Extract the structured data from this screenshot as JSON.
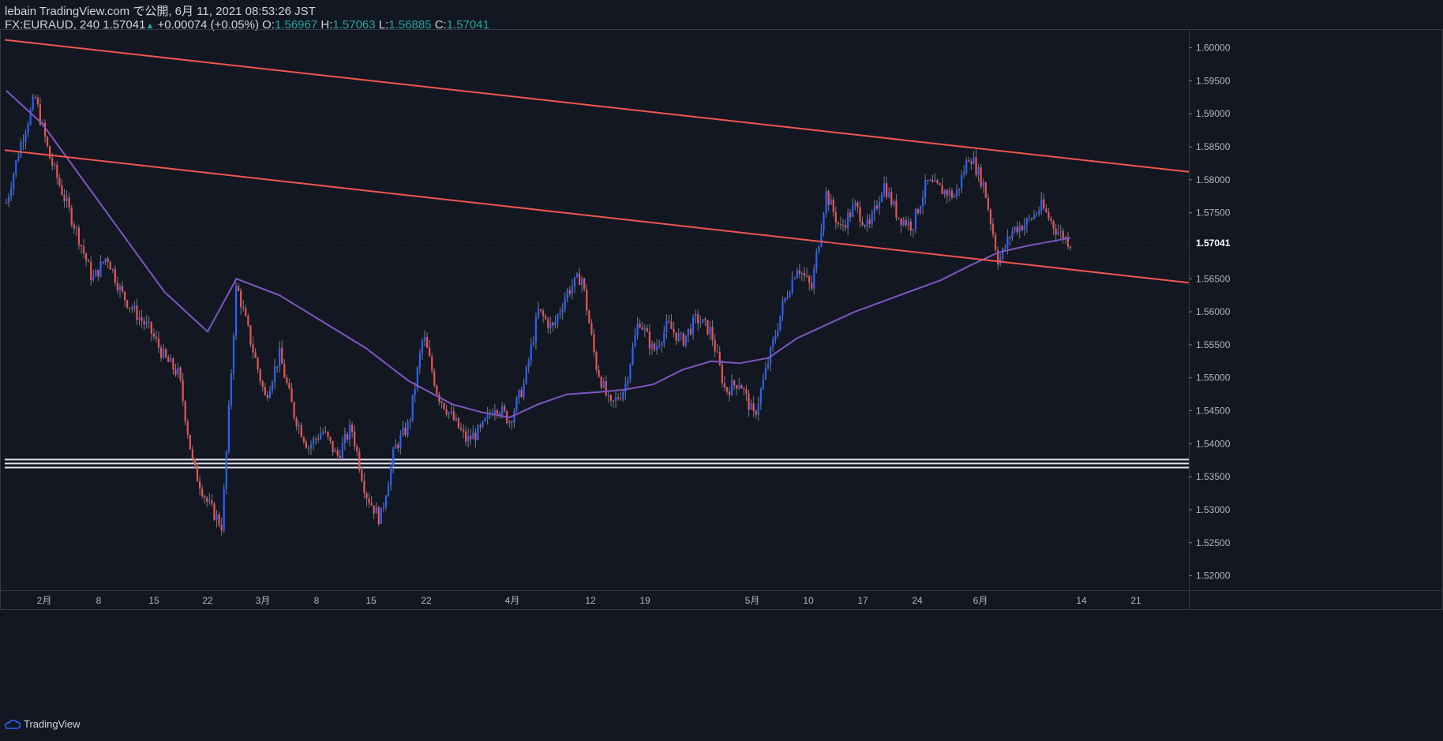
{
  "header": {
    "line1": "lebain TradingView.com で公開, 6月 11, 2021 08:53:26 JST",
    "symbol": "FX:EURAUD, 240",
    "last": "1.57041",
    "change": "+0.00074 (+0.05%)",
    "o_label": "O:",
    "o_val": "1.56967",
    "h_label": "H:",
    "h_val": "1.57063",
    "l_label": "L:",
    "l_val": "1.56885",
    "c_label": "C:",
    "c_val": "1.57041"
  },
  "footer": {
    "brand": "TradingView"
  },
  "colors": {
    "background": "#131722",
    "up": "#2962ff",
    "down": "#ef5350",
    "trendline": "#f05650",
    "ma": "#7e57c2",
    "support": "#e0e3eb"
  },
  "chart_data": {
    "type": "candlestick",
    "symbol": "FX:EURAUD",
    "timeframe": "240",
    "y_ticks": [
      "1.60000",
      "1.59500",
      "1.59000",
      "1.58500",
      "1.58000",
      "1.57500",
      "1.57000",
      "1.56500",
      "1.56000",
      "1.55500",
      "1.55000",
      "1.54500",
      "1.54000",
      "1.53500",
      "1.53000",
      "1.52500",
      "1.52000"
    ],
    "y_range": [
      1.5178,
      1.6027
    ],
    "x_ticks": [
      "2月",
      "8",
      "15",
      "22",
      "3月",
      "8",
      "15",
      "22",
      "4月",
      "12",
      "19",
      "5月",
      "10",
      "17",
      "24",
      "6月",
      "14",
      "21"
    ],
    "last_price": "1.57041",
    "price_path": [
      [
        0,
        1.5765
      ],
      [
        2,
        1.5855
      ],
      [
        4,
        1.5925
      ],
      [
        6,
        1.5835
      ],
      [
        8,
        1.5775
      ],
      [
        10,
        1.5715
      ],
      [
        12,
        1.5648
      ],
      [
        14,
        1.5685
      ],
      [
        16,
        1.5628
      ],
      [
        18,
        1.5598
      ],
      [
        20,
        1.5572
      ],
      [
        22,
        1.553
      ],
      [
        24,
        1.5505
      ],
      [
        26,
        1.5365
      ],
      [
        28,
        1.531
      ],
      [
        30,
        1.5275
      ],
      [
        32,
        1.5642
      ],
      [
        34,
        1.5555
      ],
      [
        36,
        1.547
      ],
      [
        38,
        1.5535
      ],
      [
        40,
        1.5445
      ],
      [
        42,
        1.5395
      ],
      [
        44,
        1.542
      ],
      [
        46,
        1.538
      ],
      [
        48,
        1.5425
      ],
      [
        50,
        1.5325
      ],
      [
        52,
        1.5285
      ],
      [
        54,
        1.5392
      ],
      [
        56,
        1.543
      ],
      [
        58,
        1.5565
      ],
      [
        60,
        1.5475
      ],
      [
        62,
        1.544
      ],
      [
        64,
        1.5405
      ],
      [
        66,
        1.542
      ],
      [
        68,
        1.546
      ],
      [
        70,
        1.5435
      ],
      [
        72,
        1.549
      ],
      [
        74,
        1.56
      ],
      [
        76,
        1.5575
      ],
      [
        78,
        1.563
      ],
      [
        80,
        1.5655
      ],
      [
        82,
        1.552
      ],
      [
        84,
        1.5455
      ],
      [
        86,
        1.5485
      ],
      [
        88,
        1.559
      ],
      [
        90,
        1.554
      ],
      [
        92,
        1.558
      ],
      [
        94,
        1.5555
      ],
      [
        96,
        1.559
      ],
      [
        98,
        1.557
      ],
      [
        100,
        1.548
      ],
      [
        102,
        1.5495
      ],
      [
        104,
        1.544
      ],
      [
        106,
        1.5525
      ],
      [
        108,
        1.561
      ],
      [
        110,
        1.567
      ],
      [
        112,
        1.5635
      ],
      [
        114,
        1.578
      ],
      [
        116,
        1.5725
      ],
      [
        118,
        1.576
      ],
      [
        120,
        1.5725
      ],
      [
        122,
        1.5795
      ],
      [
        124,
        1.5745
      ],
      [
        126,
        1.573
      ],
      [
        128,
        1.5795
      ],
      [
        130,
        1.5785
      ],
      [
        132,
        1.5775
      ],
      [
        134,
        1.584
      ],
      [
        136,
        1.579
      ],
      [
        138,
        1.5675
      ],
      [
        140,
        1.5725
      ],
      [
        142,
        1.5735
      ],
      [
        144,
        1.576
      ],
      [
        146,
        1.5725
      ],
      [
        148,
        1.5704
      ]
    ],
    "upper_trendline": {
      "start": 1.6012,
      "end": 1.5812
    },
    "lower_trendline": {
      "start": 1.5845,
      "end": 1.5644
    },
    "support_zone": [
      1.5364,
      1.5376
    ],
    "moving_average_path": [
      [
        0,
        1.5935
      ],
      [
        5,
        1.5885
      ],
      [
        10,
        1.581
      ],
      [
        16,
        1.572
      ],
      [
        22,
        1.563
      ],
      [
        28,
        1.557
      ],
      [
        32,
        1.565
      ],
      [
        38,
        1.5625
      ],
      [
        44,
        1.5585
      ],
      [
        50,
        1.5545
      ],
      [
        56,
        1.5495
      ],
      [
        62,
        1.546
      ],
      [
        66,
        1.5448
      ],
      [
        70,
        1.544
      ],
      [
        74,
        1.546
      ],
      [
        78,
        1.5475
      ],
      [
        82,
        1.5478
      ],
      [
        86,
        1.5482
      ],
      [
        90,
        1.549
      ],
      [
        94,
        1.5512
      ],
      [
        98,
        1.5525
      ],
      [
        102,
        1.5522
      ],
      [
        106,
        1.553
      ],
      [
        110,
        1.556
      ],
      [
        114,
        1.558
      ],
      [
        118,
        1.56
      ],
      [
        122,
        1.5616
      ],
      [
        126,
        1.5632
      ],
      [
        130,
        1.5648
      ],
      [
        134,
        1.567
      ],
      [
        138,
        1.569
      ],
      [
        142,
        1.57
      ],
      [
        146,
        1.5708
      ],
      [
        148,
        1.5712
      ]
    ]
  }
}
